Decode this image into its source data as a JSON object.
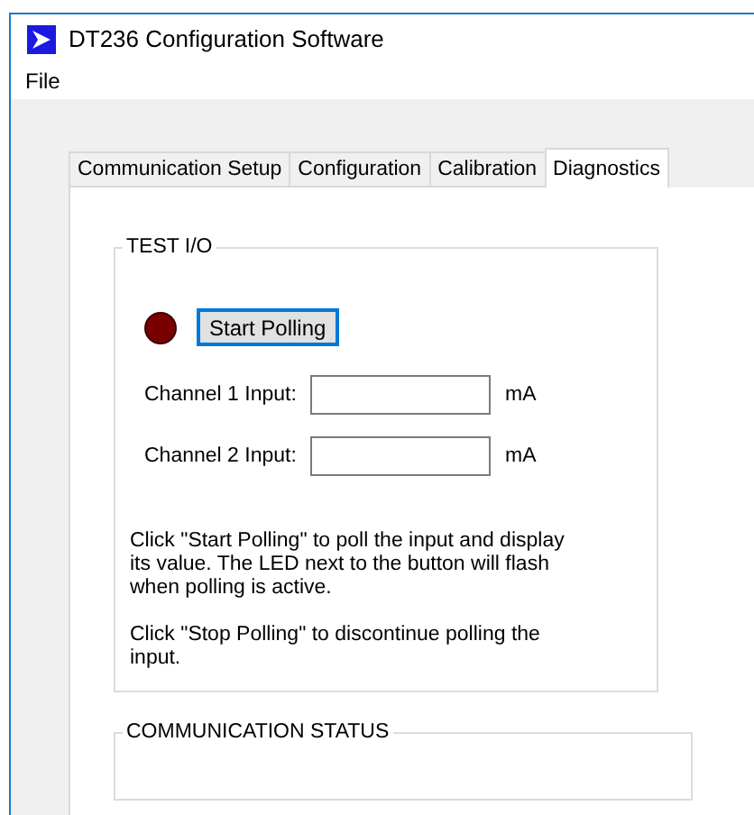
{
  "window": {
    "title": "DT236 Configuration Software"
  },
  "menu": [
    "File"
  ],
  "tabs": [
    {
      "label": "Communication Setup",
      "selected": false
    },
    {
      "label": "Configuration",
      "selected": false
    },
    {
      "label": "Calibration",
      "selected": false
    },
    {
      "label": "Diagnostics",
      "selected": true
    }
  ],
  "test_io": {
    "title": "TEST I/O",
    "led": {
      "on": false
    },
    "button": "Start Polling",
    "channels": [
      {
        "label": "Channel 1 Input:",
        "unit": "mA"
      },
      {
        "label": "Channel 2 Input:",
        "unit": "mA"
      }
    ],
    "help": [
      "Click \"Start Polling\" to poll the input and display its value. The LED next to the button will flash when polling is active.",
      "Click \"Stop Polling\" to discontinue polling the input."
    ]
  },
  "communication_status": {
    "title": "COMMUNICATION STATUS"
  }
}
